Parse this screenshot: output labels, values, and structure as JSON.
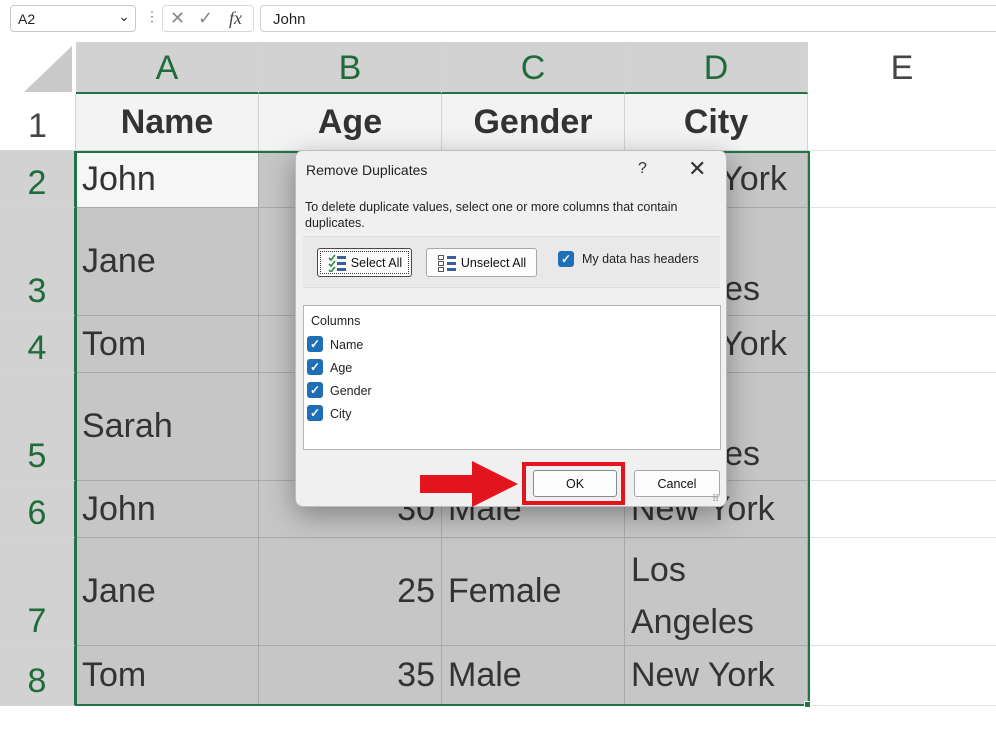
{
  "formula_bar": {
    "name_box": "A2",
    "cancel_symbol": "✕",
    "enter_symbol": "✓",
    "fx_label": "fx",
    "formula_value": "John"
  },
  "columns": [
    "A",
    "B",
    "C",
    "D",
    "E"
  ],
  "rows": [
    "1",
    "2",
    "3",
    "4",
    "5",
    "6",
    "7",
    "8"
  ],
  "headers": {
    "a": "Name",
    "b": "Age",
    "c": "Gender",
    "d": "City"
  },
  "visible_cells": {
    "r2": {
      "a": "John",
      "d": "York"
    },
    "r3": {
      "a": "Jane",
      "d": "es"
    },
    "r4": {
      "a": "Tom",
      "d": "York"
    },
    "r5": {
      "a": "Sarah",
      "d": "es"
    },
    "r6": {
      "a": "John",
      "b": "30",
      "c": "Male",
      "d": "New York"
    },
    "r7": {
      "a": "Jane",
      "b": "25",
      "c": "Female",
      "d1": "Los",
      "d2": "Angeles"
    },
    "r8": {
      "a": "Tom",
      "b": "35",
      "c": "Male",
      "d": "New York"
    }
  },
  "dialog": {
    "title": "Remove Duplicates",
    "help": "?",
    "close": "✕",
    "description": "To delete duplicate values, select one or more columns that contain duplicates.",
    "select_all_label": "Select All",
    "unselect_all_label": "Unselect All",
    "my_data_has_headers_label": "My data has headers",
    "my_data_has_headers_checked": true,
    "columns_header": "Columns",
    "columns": [
      {
        "label": "Name",
        "checked": true
      },
      {
        "label": "Age",
        "checked": true
      },
      {
        "label": "Gender",
        "checked": true
      },
      {
        "label": "City",
        "checked": true
      }
    ],
    "ok_label": "OK",
    "cancel_label": "Cancel"
  },
  "colors": {
    "selection_green": "#217346",
    "highlight_red": "#e3141e",
    "checkbox_blue": "#1f6fb7"
  }
}
